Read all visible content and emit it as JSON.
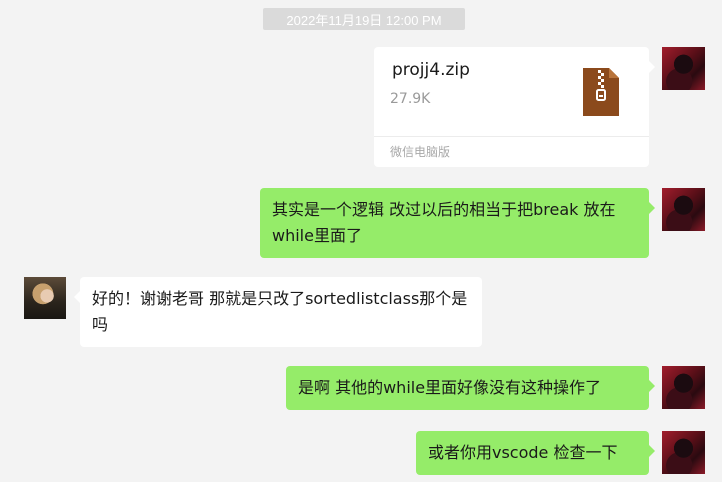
{
  "timestamp": "2022年11月19日 12:00 PM",
  "file": {
    "name": "projj4.zip",
    "size": "27.9K",
    "source": "微信电脑版",
    "icon": "zip-file-icon"
  },
  "messages": [
    {
      "sender": "me",
      "text": "其实是一个逻辑 改过以后的相当于把break 放在while里面了"
    },
    {
      "sender": "other",
      "text": "好的！谢谢老哥 那就是只改了sortedlistclass那个是吗"
    },
    {
      "sender": "me",
      "text": "是啊 其他的while里面好像没有这种操作了"
    },
    {
      "sender": "me",
      "text": "或者你用vscode 检查一下"
    }
  ],
  "colors": {
    "background": "#f3f3f3",
    "my_bubble": "#95ec69",
    "their_bubble": "#ffffff",
    "zip_icon": "#8b4a1c"
  }
}
